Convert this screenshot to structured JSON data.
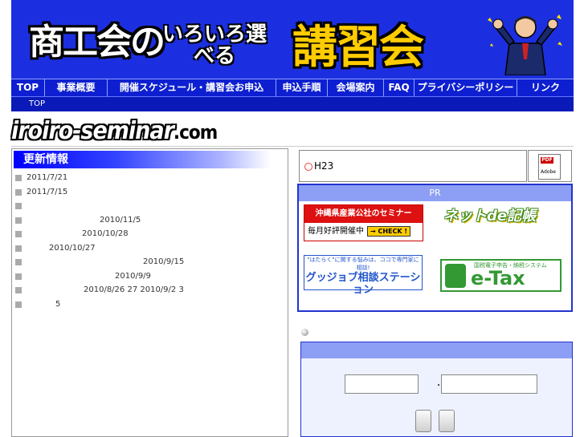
{
  "banner": {
    "title_part1": "商工会の",
    "title_part2": "いろいろ選べる",
    "title_part3": "講習会"
  },
  "nav": {
    "items": [
      {
        "label": "TOP",
        "width": 42
      },
      {
        "label": "事業概要",
        "width": 78
      },
      {
        "label": "開催スケジュール・講習会お申込",
        "width": 210
      },
      {
        "label": "申込手順",
        "width": 64
      },
      {
        "label": "会場案内",
        "width": 70
      },
      {
        "label": "FAQ",
        "width": 38
      },
      {
        "label": "プライバシーポリシー",
        "width": 128
      },
      {
        "label": "リンク",
        "width": 70
      }
    ]
  },
  "breadcrumb": {
    "current": "TOP"
  },
  "site_logo": {
    "name": "iroiro-seminar",
    "tld": ".com"
  },
  "updates": {
    "header": "更新情報",
    "items": [
      {
        "text": "2011/7/21",
        "indent": 14
      },
      {
        "text": "2011/7/15",
        "indent": 14
      },
      {
        "text": "",
        "indent": 14
      },
      {
        "text": "2010/11/5",
        "indent": 105
      },
      {
        "text": "2010/10/28",
        "indent": 83
      },
      {
        "text": "2010/10/27",
        "indent": 42
      },
      {
        "text": "2010/9/15",
        "indent": 159
      },
      {
        "text": "2010/9/9",
        "indent": 124
      },
      {
        "text": "2010/8/26 27 2010/9/2 3",
        "indent": 85
      },
      {
        "text": "5",
        "indent": 50
      }
    ]
  },
  "notice": {
    "text": "H23"
  },
  "pdf": {
    "tag": "PDF",
    "label": "Adobe"
  },
  "pr": {
    "header": "PR",
    "okinawa_title": "沖縄県産業公社のセミナー",
    "okinawa_sub": "毎月好評開催中",
    "okinawa_check": "→ CHECK !",
    "netde": "ネットde記帳",
    "goodjob_top": "\"はたらく\"に関する悩みは、ココで専門家に相談!",
    "goodjob_main": "グッジョブ相談ステーション",
    "etax_sys": "国税電子申告・納税システム",
    "etax": "e-Tax"
  },
  "login": {
    "separator": "・"
  }
}
